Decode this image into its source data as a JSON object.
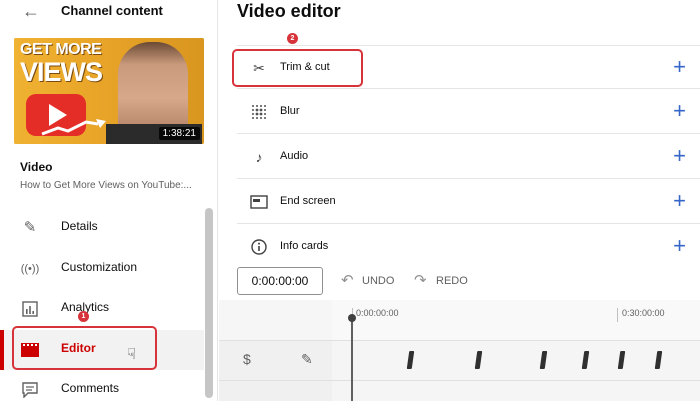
{
  "sidebar": {
    "title": "Channel content",
    "thumbnail": {
      "headline_1": "GET MORE",
      "headline_2": "VIEWS",
      "duration": "1:38:21"
    },
    "video_label": "Video",
    "video_title": "How to Get More Views on YouTube:...",
    "nav": [
      {
        "label": "Details",
        "icon": "pencil-icon"
      },
      {
        "label": "Customization",
        "icon": "broadcast-icon"
      },
      {
        "label": "Analytics",
        "icon": "bar-chart-icon"
      },
      {
        "label": "Editor",
        "icon": "film-icon",
        "active": true
      },
      {
        "label": "Comments",
        "icon": "comment-icon"
      }
    ],
    "badge_1": "1"
  },
  "editor": {
    "title": "Video editor",
    "badge_2": "2",
    "tools": [
      {
        "label": "Trim & cut",
        "icon": "scissors-icon"
      },
      {
        "label": "Blur",
        "icon": "blur-grid-icon"
      },
      {
        "label": "Audio",
        "icon": "music-note-icon"
      },
      {
        "label": "End screen",
        "icon": "end-screen-icon"
      },
      {
        "label": "Info cards",
        "icon": "info-icon"
      }
    ],
    "timecode": "0:00:00:00",
    "undo_label": "UNDO",
    "redo_label": "REDO",
    "timeline": {
      "start_label": "0:00:00:00",
      "end_label": "0:30:00:00"
    }
  },
  "colors": {
    "accent_red": "#cc0000",
    "highlight_red": "#d6343a",
    "plus_blue": "#3766c9"
  }
}
